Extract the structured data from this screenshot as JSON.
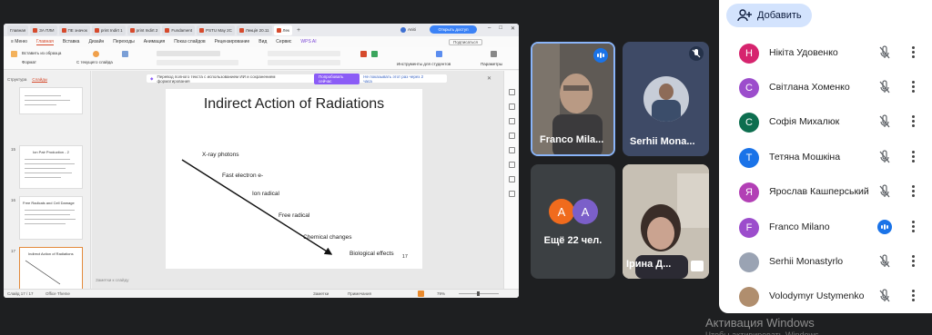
{
  "browser_tabs": [
    "Главная",
    "ЗА ПЛИ",
    "ПЕ значок",
    "print Indirt 1",
    "print Indirt 2",
    "Fundament",
    "PSTU May 2C",
    "Лекція 20.11",
    "Лек"
  ],
  "account_name": "Aniti",
  "share_button": "Открыть доступ",
  "menu": {
    "items": [
      "≡ Меню",
      "Главная",
      "Вставка",
      "Дизайн",
      "Переходы",
      "Анимация",
      "Показ слайдов",
      "Рецензирование",
      "Вид",
      "Сервис",
      "WPS AI"
    ],
    "active": "Главная",
    "tool": "Подписаться"
  },
  "ribbon": {
    "paste": "Вставить из образца",
    "from_start": "С текущего слайда",
    "tools": "Инструменты для студентов",
    "params": "Параметры",
    "format_painter": "Формат"
  },
  "left_pane": {
    "tabs": [
      "Структура",
      "Слайды"
    ],
    "thumbs": [
      {
        "num": "",
        "title": ""
      },
      {
        "num": "15",
        "title": "Ion Pair Production - 2"
      },
      {
        "num": "16",
        "title": "Free Radicals and Cell Damage"
      },
      {
        "num": "17",
        "title": "Indirect Action of Radiations"
      }
    ],
    "add_label": "+"
  },
  "ai_banner": {
    "text": "Перевод полного текста с использованием ИИ и сохранением форматирования",
    "button": "Попробовать сейчас",
    "link": "Не показывать этот раз через 2 часа"
  },
  "slide": {
    "title": "Indirect Action of Radiations",
    "lines": [
      "X-ray photons",
      "Fast electron e-",
      "Ion radical",
      "Free radical",
      "Chemical changes",
      "Biological effects"
    ],
    "number": "17"
  },
  "notes_placeholder": "Заметки к слайду",
  "status": {
    "slide_count": "Слайд 17 / 17",
    "theme": "Office Theme",
    "notes": "Заметки",
    "comments": "Примечания",
    "zoom": "79%"
  },
  "tiles": {
    "franco": "Franco Mila...",
    "serhii": "Serhii Mona...",
    "more": "Ещё 22 чел.",
    "more_avatars": [
      "А",
      "А"
    ],
    "iryna": "Ірина Д..."
  },
  "panel": {
    "add_label": "Добавить",
    "participants": [
      {
        "initial": "Н",
        "name": "Нікіта Удовенко",
        "color": "#d6246e",
        "mic": "muted"
      },
      {
        "initial": "С",
        "name": "Світлана Хоменко",
        "color": "#9c4dcc",
        "mic": "muted"
      },
      {
        "initial": "С",
        "name": "Софія Михалюк",
        "color": "#0d6e4f",
        "mic": "muted"
      },
      {
        "initial": "Т",
        "name": "Тетяна Мошкіна",
        "color": "#1a73e8",
        "mic": "muted"
      },
      {
        "initial": "Я",
        "name": "Ярослав Кашперський",
        "color": "#b23fb5",
        "mic": "muted"
      },
      {
        "initial": "F",
        "name": "Franco Milano",
        "color": "#9c4dcc",
        "mic": "speaking"
      },
      {
        "initial": "",
        "name": "Serhii Monastyrlo",
        "color": "#9aa3b3",
        "mic": "muted"
      },
      {
        "initial": "",
        "name": "Volodymyr Ustymenko",
        "color": "#b08e6e",
        "mic": "muted"
      }
    ]
  },
  "watermark": "Активация Windows",
  "watermark_sub": "Чтобы активировать Windows, перейдите в раздел"
}
